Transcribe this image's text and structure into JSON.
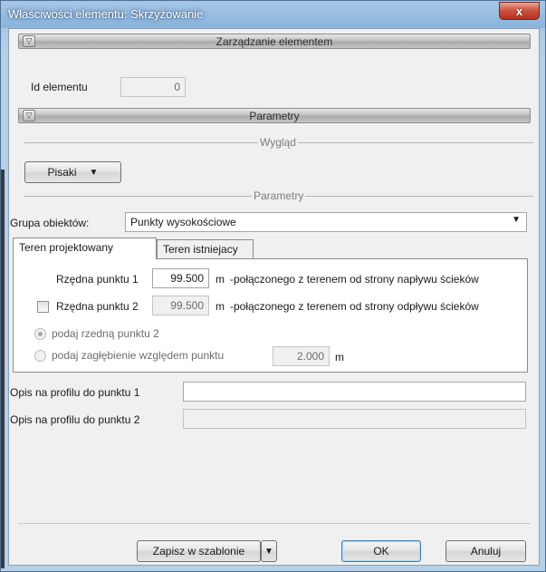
{
  "window": {
    "title": "Właściwości elementu: Skrzyżowanie",
    "close_glyph": "x"
  },
  "section_management": {
    "title": "Zarządzanie elementem",
    "collapse_glyph": "▽"
  },
  "element_id": {
    "label": "Id elementu",
    "value": "0"
  },
  "section_params": {
    "title": "Parametry",
    "collapse_glyph": "▽"
  },
  "look_group": {
    "title": "Wygląd",
    "pens_button": "Pisaki",
    "pens_arrow": "▼"
  },
  "params_group": {
    "title": "Parametry"
  },
  "object_group": {
    "label": "Grupa obiektów:",
    "selected": "Punkty wysokościowe",
    "arrow": "▼"
  },
  "tabs": [
    {
      "label": "Teren projektowany",
      "active": true
    },
    {
      "label": "Teren istniejacy",
      "active": false
    }
  ],
  "point1": {
    "label": "Rzędna punktu 1",
    "value": "99.500",
    "unit": "m",
    "description": "-połączonego z terenem od strony napływu ścieków"
  },
  "point2": {
    "label": "Rzędna punktu 2",
    "value": "99.500",
    "unit": "m",
    "description": "-połączonego z terenem od strony odpływu ścieków",
    "checked": false
  },
  "radio_ordinate": {
    "label": "podaj rzedną punktu 2",
    "checked": true
  },
  "radio_depth": {
    "label": "podaj zagłębienie względem punktu",
    "value": "2.000",
    "unit": "m",
    "checked": false
  },
  "profile1": {
    "label": "Opis na profilu do punktu 1",
    "value": ""
  },
  "profile2": {
    "label": "Opis na profilu do punktu 2",
    "value": ""
  },
  "footer": {
    "save_template": "Zapisz w szablonie",
    "save_arrow": "▼",
    "ok": "OK",
    "cancel": "Anuluj"
  }
}
